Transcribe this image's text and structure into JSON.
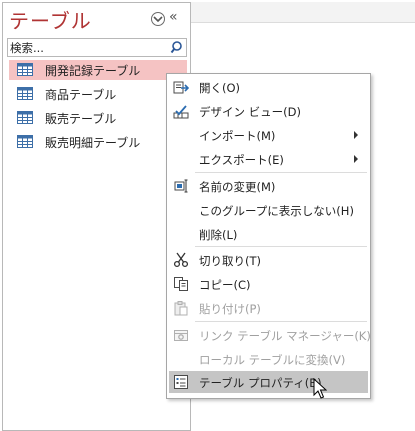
{
  "nav": {
    "title": "テーブル",
    "search_placeholder": "検索...",
    "items": [
      {
        "label": "開発記録テーブル",
        "selected": true
      },
      {
        "label": "商品テーブル",
        "selected": false
      },
      {
        "label": "販売テーブル",
        "selected": false
      },
      {
        "label": "販売明細テーブル",
        "selected": false
      }
    ]
  },
  "context_menu": {
    "items": [
      {
        "label": "開く(O)",
        "icon": "open-icon",
        "enabled": true
      },
      {
        "label": "デザイン ビュー(D)",
        "icon": "design-view-icon",
        "enabled": true
      },
      {
        "label": "インポート(M)",
        "icon": "",
        "enabled": true,
        "submenu": true
      },
      {
        "label": "エクスポート(E)",
        "icon": "",
        "enabled": true,
        "submenu": true
      },
      {
        "label": "名前の変更(M)",
        "icon": "rename-icon",
        "enabled": true
      },
      {
        "label": "このグループに表示しない(H)",
        "icon": "",
        "enabled": true
      },
      {
        "label": "削除(L)",
        "icon": "",
        "enabled": true
      },
      {
        "label": "切り取り(T)",
        "icon": "scissors-icon",
        "enabled": true
      },
      {
        "label": "コピー(C)",
        "icon": "copy-icon",
        "enabled": true
      },
      {
        "label": "貼り付け(P)",
        "icon": "paste-icon",
        "enabled": false
      },
      {
        "label": "リンク テーブル マネージャー(K)",
        "icon": "link-table-manager-icon",
        "enabled": false
      },
      {
        "label": "ローカル テーブルに変換(V)",
        "icon": "",
        "enabled": false
      },
      {
        "label": "テーブル プロパティ(B)",
        "icon": "table-properties-icon",
        "enabled": true,
        "highlighted": true
      }
    ]
  },
  "colors": {
    "title": "#b03434",
    "selected_item_bg": "#f5c3c3",
    "menu_highlight_bg": "#c5c5c5",
    "disabled_text": "#a0a0a0",
    "table_icon": "#3d6fa8"
  }
}
